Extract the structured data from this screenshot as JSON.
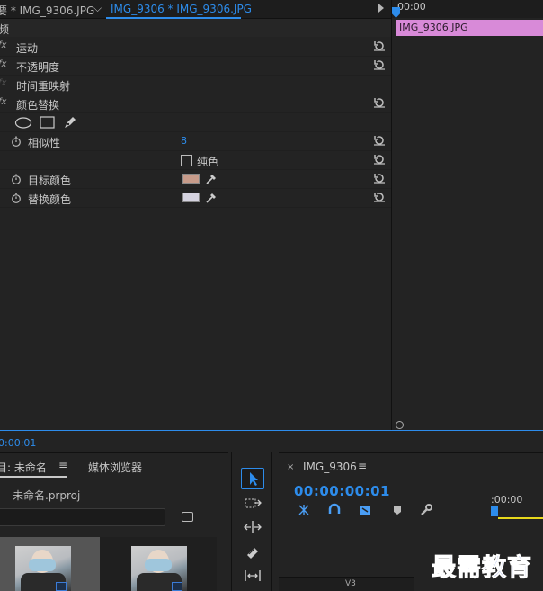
{
  "effect_controls": {
    "tabs": {
      "source": "要 * IMG_9306.JPG",
      "clip": "IMG_9306 * IMG_9306.JPG"
    },
    "section_header": "频",
    "properties": [
      {
        "fx": "fx",
        "label": "运动"
      },
      {
        "fx": "fx",
        "label": "不透明度"
      },
      {
        "fx": "fx",
        "label": "时间重映射"
      },
      {
        "fx": "fx",
        "label": "颜色替换"
      }
    ],
    "similarity": {
      "label": "相似性",
      "value": "8"
    },
    "solid_color": {
      "label": "纯色"
    },
    "target_color": {
      "label": "目标颜色",
      "swatch": "#c79b8a"
    },
    "replace_color": {
      "label": "替换颜色",
      "swatch": "#d5d3e0"
    },
    "current_time": "0:00:01",
    "timeline": {
      "ruler_time": "00:00",
      "clip_name": "IMG_9306.JPG",
      "clip_color": "#d88ad8"
    }
  },
  "project": {
    "tab_label": "目: 未命名",
    "tab_menu": "≡",
    "media_browser_tab": "媒体浏览器",
    "file_name": "未命名.prproj",
    "search_placeholder": ""
  },
  "sequence": {
    "close": "×",
    "title": "IMG_9306",
    "menu": "≡",
    "timecode": "00:00:00:01",
    "ruler_time": ":00:00",
    "track_label": "V3"
  },
  "watermark": "最需教育",
  "colors": {
    "accent": "#2d8ceb",
    "panel_bg": "#232323",
    "playhead_yellow": "#e8d81c"
  }
}
